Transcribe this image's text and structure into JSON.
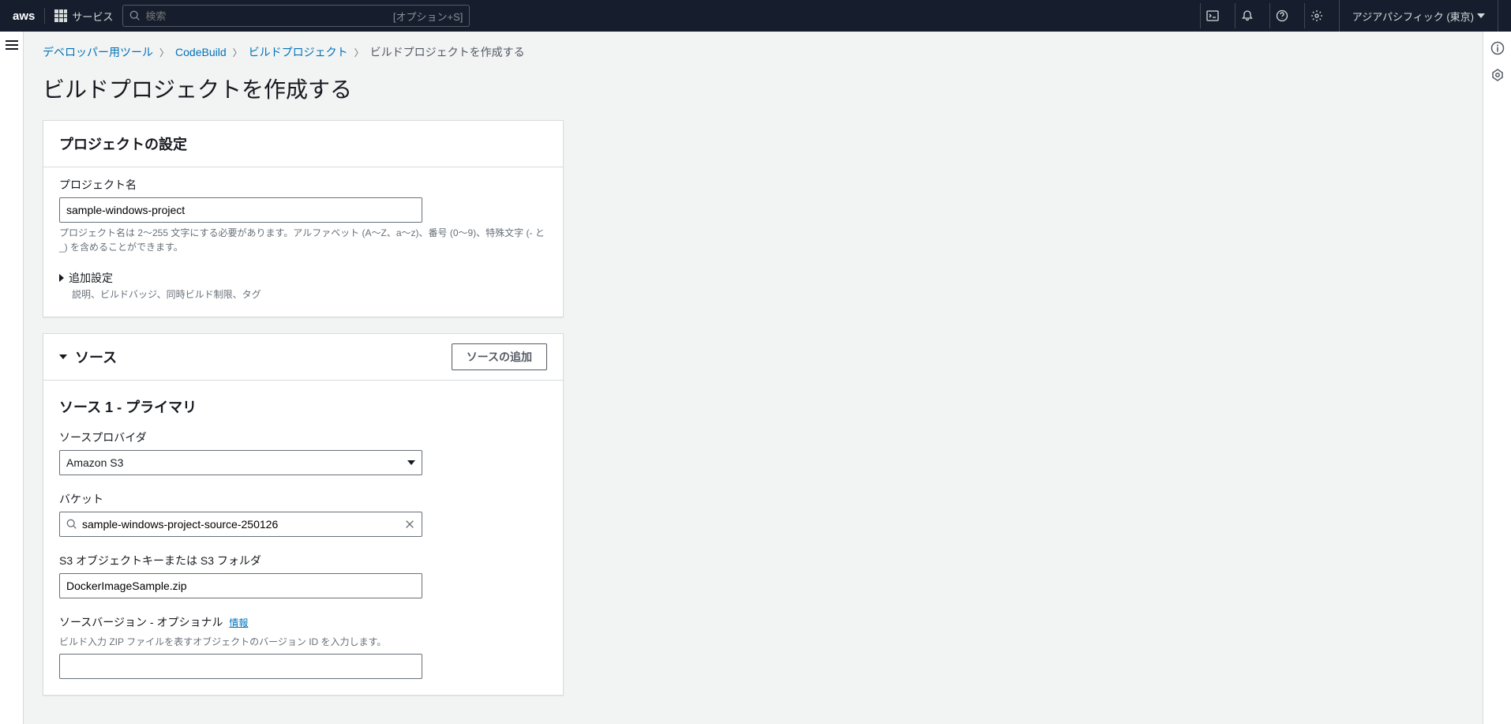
{
  "nav": {
    "services_label": "サービス",
    "search_placeholder": "検索",
    "search_hint": "[オプション+S]",
    "region": "アジアパシフィック (東京)"
  },
  "breadcrumb": {
    "items": [
      "デベロッパー用ツール",
      "CodeBuild",
      "ビルドプロジェクト"
    ],
    "current": "ビルドプロジェクトを作成する"
  },
  "page_title": "ビルドプロジェクトを作成する",
  "project_settings": {
    "panel_title": "プロジェクトの設定",
    "name_label": "プロジェクト名",
    "name_value": "sample-windows-project",
    "name_hint": "プロジェクト名は 2〜255 文字にする必要があります。アルファベット (A〜Z、a〜z)、番号 (0〜9)、特殊文字 (- と _) を含めることができます。",
    "additional_label": "追加設定",
    "additional_sub": "説明、ビルドバッジ、同時ビルド制限、タグ"
  },
  "source": {
    "panel_title": "ソース",
    "add_button": "ソースの追加",
    "primary_title": "ソース 1 - プライマリ",
    "provider_label": "ソースプロバイダ",
    "provider_value": "Amazon S3",
    "bucket_label": "バケット",
    "bucket_value": "sample-windows-project-source-250126",
    "object_key_label": "S3 オブジェクトキーまたは S3 フォルダ",
    "object_key_value": "DockerImageSample.zip",
    "version_label": "ソースバージョン - オプショナル",
    "version_info": "情報",
    "version_hint": "ビルド入力 ZIP ファイルを表すオブジェクトのバージョン ID を入力します。",
    "version_value": ""
  }
}
